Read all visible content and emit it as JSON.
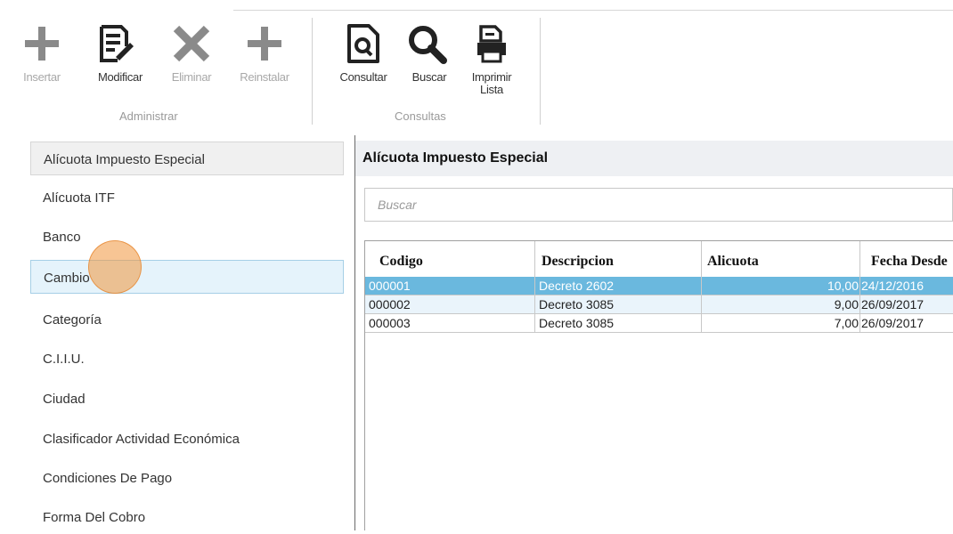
{
  "ribbon": {
    "groups": [
      {
        "label": "Administrar"
      },
      {
        "label": "Consultas"
      }
    ],
    "tools": [
      {
        "label": "Insertar",
        "icon": "plus-icon",
        "enabled": false
      },
      {
        "label": "Modificar",
        "icon": "edit-document-icon",
        "enabled": true
      },
      {
        "label": "Eliminar",
        "icon": "delete-x-icon",
        "enabled": false
      },
      {
        "label": "Reinstalar",
        "icon": "plus-icon",
        "enabled": false
      },
      {
        "label": "Consultar",
        "icon": "view-document-icon",
        "enabled": true
      },
      {
        "label": "Buscar",
        "icon": "search-icon",
        "enabled": true
      },
      {
        "label": "Imprimir\nLista",
        "icon": "print-icon",
        "enabled": true
      }
    ]
  },
  "sidebar": {
    "items": [
      {
        "label": "Alícuota Impuesto Especial"
      },
      {
        "label": "Alícuota ITF"
      },
      {
        "label": "Banco"
      },
      {
        "label": "Cambio"
      },
      {
        "label": "Categoría"
      },
      {
        "label": "C.I.I.U."
      },
      {
        "label": "Ciudad"
      },
      {
        "label": "Clasificador Actividad Económica"
      },
      {
        "label": "Condiciones De Pago"
      },
      {
        "label": "Forma Del Cobro"
      }
    ]
  },
  "main": {
    "title": "Alícuota Impuesto Especial",
    "search_placeholder": "Buscar"
  },
  "table": {
    "columns": [
      "Codigo",
      "Descripcion",
      "Alicuota",
      "Fecha Desde"
    ],
    "rows": [
      {
        "codigo": "000001",
        "descripcion": "Decreto 2602",
        "alicuota": "10,00",
        "fecha": "24/12/2016"
      },
      {
        "codigo": "000002",
        "descripcion": "Decreto 3085",
        "alicuota": "9,00",
        "fecha": "26/09/2017"
      },
      {
        "codigo": "000003",
        "descripcion": "Decreto 3085",
        "alicuota": "7,00",
        "fecha": "26/09/2017"
      }
    ]
  },
  "colors": {
    "selected_row": "#6ab8de",
    "alt_row": "#eaf4fb",
    "header_bg": "#eef0f3",
    "click_indicator": "#f0963c"
  }
}
